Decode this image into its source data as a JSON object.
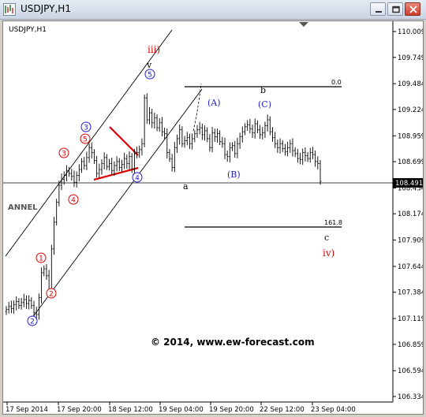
{
  "window": {
    "title": "USDJPY,H1",
    "minimize_icon": "minimize-icon",
    "maximize_icon": "maximize-icon",
    "close_icon": "close-icon"
  },
  "chart_data": {
    "type": "candlestick",
    "symbol_label": "USDJPY,H1",
    "y_ticks": [
      "110.009",
      "109.749",
      "109.484",
      "109.224",
      "108.959",
      "108.699",
      "108.434",
      "108.174",
      "107.909",
      "107.644",
      "107.384",
      "107.119",
      "106.859",
      "106.594",
      "106.334"
    ],
    "y_range": [
      106.334,
      110.009
    ],
    "x_ticks": [
      "17 Sep 2014",
      "17 Sep 20:00",
      "18 Sep 12:00",
      "19 Sep 04:00",
      "19 Sep 20:00",
      "22 Sep 12:00",
      "23 Sep 04:00"
    ],
    "current_price": "108.491",
    "colors": {
      "candles": "#000000",
      "channel": "#000000",
      "wedge": "#dd0000",
      "red_label": "#dd0000",
      "blue_label": "#1f1fcc",
      "price_badge_bg": "#000000",
      "price_badge_text": "#ffffff"
    },
    "close_series": [
      107.21,
      107.24,
      107.22,
      107.26,
      107.29,
      107.25,
      107.28,
      107.31,
      107.27,
      107.3,
      107.25,
      107.18,
      107.16,
      107.33,
      107.58,
      107.62,
      107.55,
      107.41,
      107.82,
      108.09,
      108.29,
      108.46,
      108.52,
      108.56,
      108.61,
      108.58,
      108.55,
      108.49,
      108.56,
      108.62,
      108.7,
      108.66,
      108.74,
      108.84,
      108.79,
      108.71,
      108.58,
      108.62,
      108.68,
      108.74,
      108.65,
      108.68,
      108.61,
      108.66,
      108.7,
      108.64,
      108.67,
      108.73,
      108.68,
      108.75,
      108.62,
      108.78,
      108.79,
      108.82,
      108.88,
      109.34,
      109.12,
      109.19,
      109.09,
      109.14,
      109.04,
      109.09,
      109.0,
      108.98,
      108.79,
      108.73,
      108.64,
      108.84,
      108.93,
      109.02,
      108.88,
      108.91,
      108.94,
      108.88,
      108.93,
      108.98,
      109.02,
      109.04,
      108.97,
      109.01,
      108.93,
      108.84,
      108.99,
      108.95,
      108.98,
      108.9,
      108.88,
      108.77,
      108.75,
      108.84,
      108.86,
      108.78,
      108.88,
      108.95,
      109.0,
      109.05,
      109.07,
      109.03,
      108.99,
      109.08,
      109.02,
      108.97,
      108.99,
      109.06,
      109.12,
      109.0,
      108.94,
      108.88,
      108.84,
      108.88,
      108.83,
      108.8,
      108.84,
      108.88,
      108.81,
      108.78,
      108.73,
      108.72,
      108.79,
      108.76,
      108.73,
      108.79,
      108.77,
      108.7,
      108.68,
      108.5
    ],
    "levels": [
      {
        "label": "0.0",
        "price": 109.484
      },
      {
        "label": "161.8",
        "price": 108.008
      }
    ],
    "wave_labels": [
      {
        "text": "iii)",
        "color": "red"
      },
      {
        "text": "v",
        "color": "black"
      },
      {
        "text": "5",
        "color": "blue",
        "circled": true
      },
      {
        "text": "3",
        "color": "blue",
        "circled": true
      },
      {
        "text": "5",
        "color": "red",
        "circled": true
      },
      {
        "text": "3",
        "color": "red",
        "circled": true
      },
      {
        "text": "4",
        "color": "red",
        "circled": true
      },
      {
        "text": "1",
        "color": "red",
        "circled": true
      },
      {
        "text": "2",
        "color": "red",
        "circled": true
      },
      {
        "text": "2",
        "color": "blue",
        "circled": true
      },
      {
        "text": "4",
        "color": "blue",
        "circled": true
      },
      {
        "text": "a",
        "color": "black"
      },
      {
        "text": "b",
        "color": "black"
      },
      {
        "text": "(A)",
        "color": "blue"
      },
      {
        "text": "(C)",
        "color": "blue"
      },
      {
        "text": "(B)",
        "color": "blue"
      },
      {
        "text": "c",
        "color": "black"
      },
      {
        "text": "iv)",
        "color": "red"
      }
    ],
    "left_watermark": "ANNEL",
    "copyright": "© 2014, www.ew-forecast.com"
  }
}
